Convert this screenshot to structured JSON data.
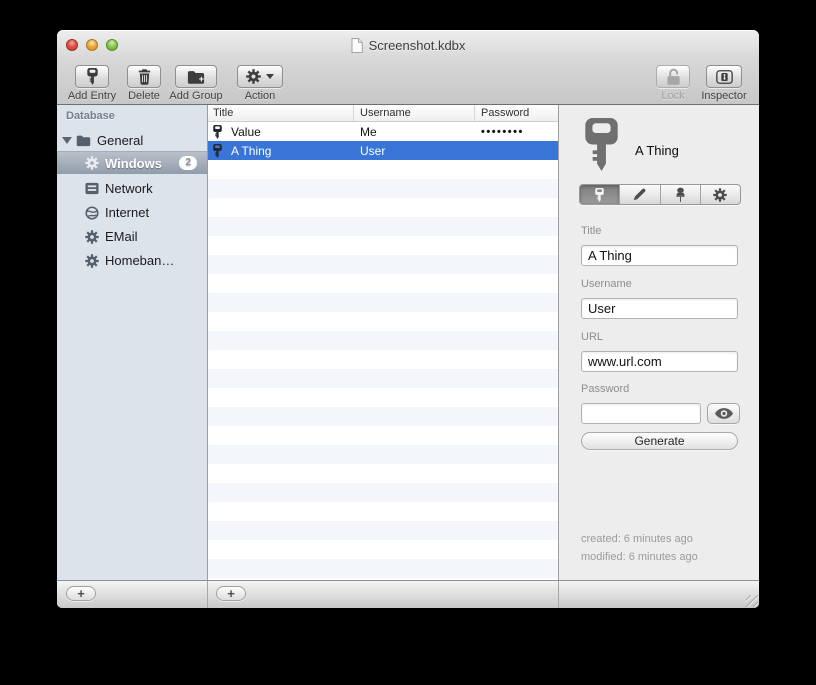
{
  "window": {
    "title": "Screenshot.kdbx"
  },
  "toolbar": {
    "add_entry": "Add Entry",
    "delete": "Delete",
    "add_group": "Add Group",
    "action": "Action",
    "lock": "Lock",
    "inspector": "Inspector"
  },
  "sidebar": {
    "header": "Database",
    "group": {
      "label": "General"
    },
    "items": [
      {
        "label": "Windows",
        "badge": "2",
        "selected": true,
        "icon": "gear-icon"
      },
      {
        "label": "Network",
        "icon": "display-icon"
      },
      {
        "label": "Internet",
        "icon": "globe-icon"
      },
      {
        "label": "EMail",
        "icon": "gear-icon"
      },
      {
        "label": "Homeban…",
        "icon": "gear-icon"
      }
    ]
  },
  "table": {
    "columns": [
      "Title",
      "Username",
      "Password"
    ],
    "rows": [
      {
        "title": "Value",
        "username": "Me",
        "password": "••••••••",
        "selected": false
      },
      {
        "title": "A Thing",
        "username": "User",
        "password": "",
        "selected": true
      }
    ],
    "add_row_label": "+"
  },
  "inspector": {
    "entry_title": "A Thing",
    "tabs": [
      "key-tab",
      "pencil-tab",
      "pin-tab",
      "gear-tab"
    ],
    "title_label": "Title",
    "title_value": "A Thing",
    "username_label": "Username",
    "username_value": "User",
    "url_label": "URL",
    "url_value": "www.url.com",
    "password_label": "Password",
    "password_value": "",
    "generate_label": "Generate",
    "created": "created: 6 minutes ago",
    "modified": "modified: 6 minutes ago"
  },
  "bottombar": {
    "add_group_label": "+",
    "add_entry_label": "+"
  },
  "colors": {
    "selection_blue": "#3875d7",
    "sidebar_bg": "#dce3ea",
    "sidebar_selection": "#929daa",
    "alt_row": "#f3f6fa",
    "inspector_bg": "#ededed"
  }
}
